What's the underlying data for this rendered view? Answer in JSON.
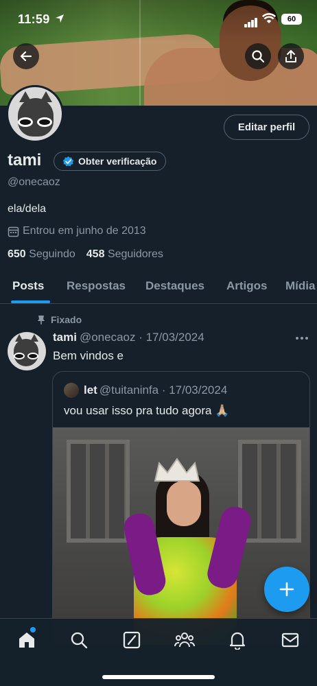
{
  "status_bar": {
    "time": "11:59",
    "battery": "60"
  },
  "profile": {
    "name": "tami",
    "verify_label": "Obter verificação",
    "handle": "@onecaoz",
    "bio": "ela/dela",
    "joined": "Entrou em junho de 2013",
    "following_count": "650",
    "following_label": "Seguindo",
    "followers_count": "458",
    "followers_label": "Seguidores",
    "edit_label": "Editar perfil"
  },
  "tabs": [
    {
      "label": "Posts",
      "active": true
    },
    {
      "label": "Respostas",
      "active": false
    },
    {
      "label": "Destaques",
      "active": false
    },
    {
      "label": "Artigos",
      "active": false
    },
    {
      "label": "Mídia",
      "active": false
    }
  ],
  "pinned_tweet": {
    "pinned_label": "Fixado",
    "author_name": "tami",
    "author_meta": "@onecaoz · 17/03/2024",
    "text": "Bem vindos e",
    "quote": {
      "author_name": "let",
      "author_meta": "@tuitaninfa · 17/03/2024",
      "text": "vou usar isso pra tudo agora 🙏🏼"
    }
  },
  "icons": {
    "back": "arrow-left-icon",
    "search": "search-icon",
    "share": "share-icon",
    "fab": "plus-icon",
    "nav": [
      "home-icon",
      "search-icon",
      "grok-icon",
      "communities-icon",
      "bell-icon",
      "mail-icon"
    ]
  },
  "colors": {
    "accent": "#1d9bf0",
    "background": "#15202b",
    "muted": "#8b98a5",
    "border": "#38444d"
  }
}
